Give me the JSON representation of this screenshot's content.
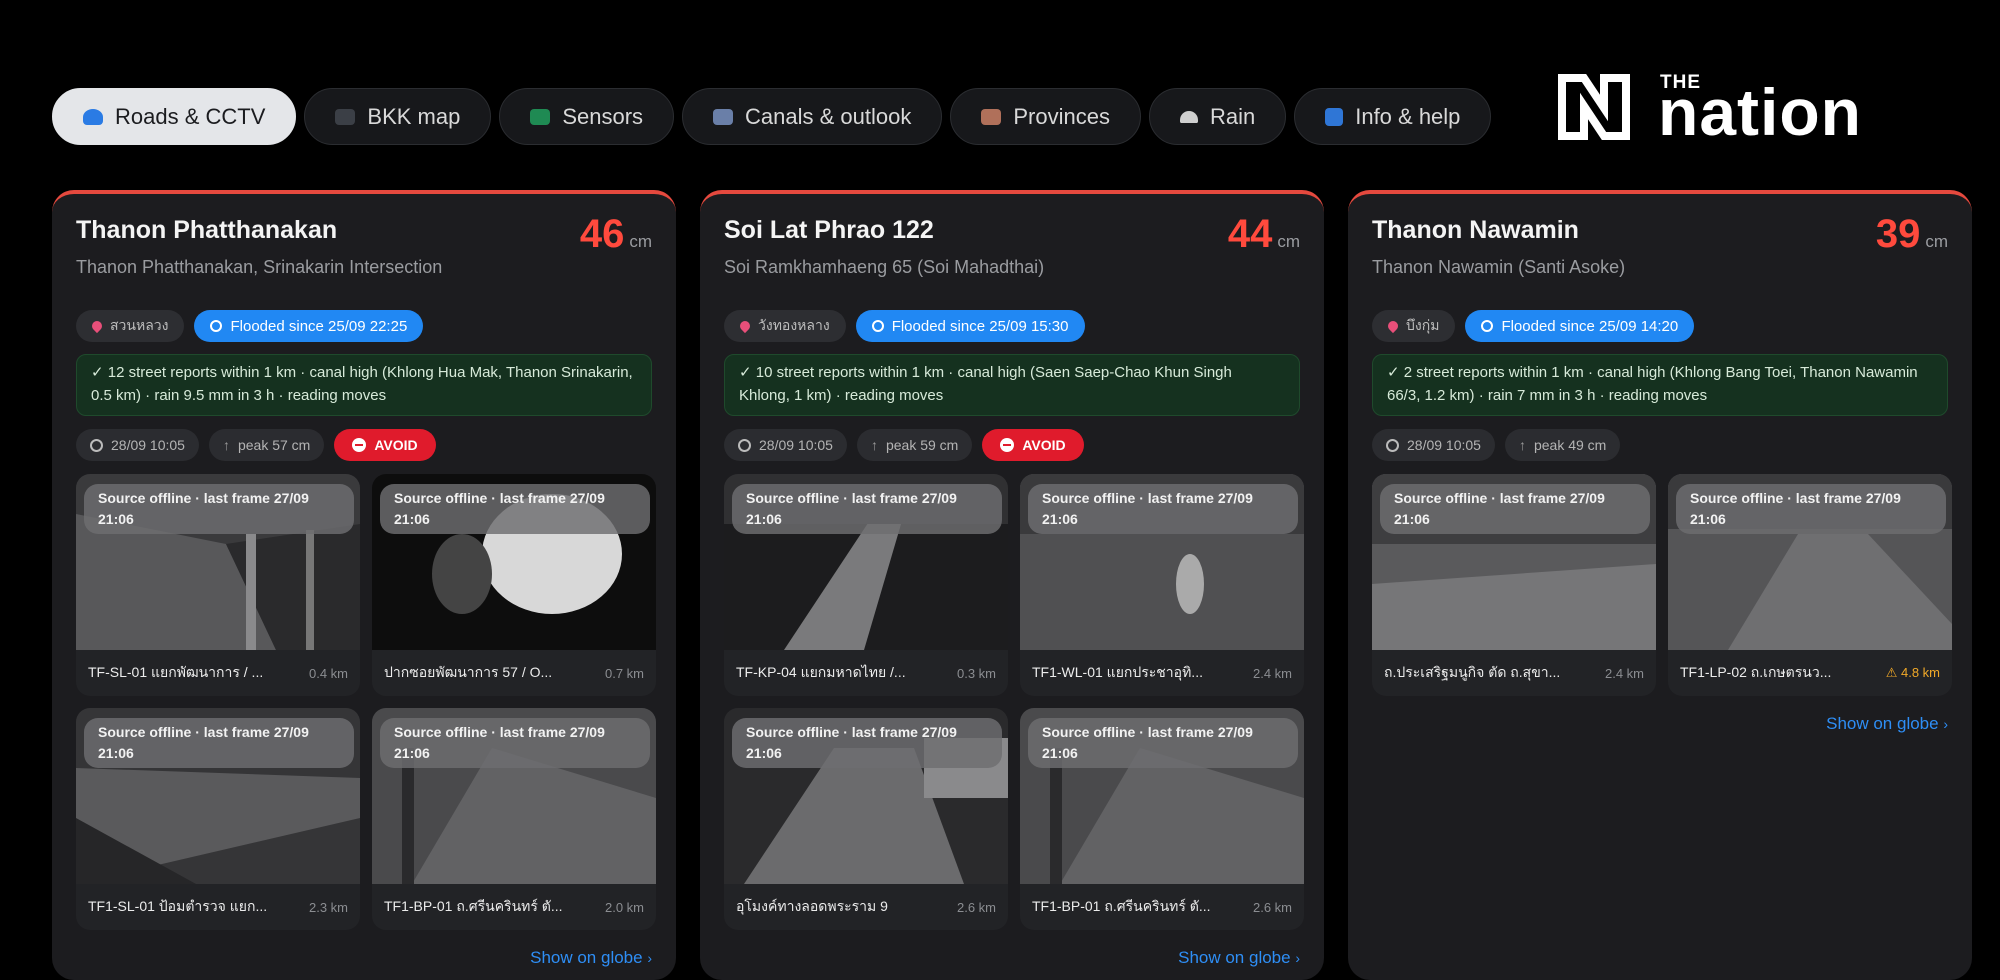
{
  "tabs": [
    {
      "label": "Roads & CCTV",
      "icon": "wave-icon",
      "active": true
    },
    {
      "label": "BKK map",
      "icon": "map-icon",
      "active": false
    },
    {
      "label": "Sensors",
      "icon": "sensor-icon",
      "active": false
    },
    {
      "label": "Canals & outlook",
      "icon": "chart-icon",
      "active": false
    },
    {
      "label": "Provinces",
      "icon": "provinces-icon",
      "active": false
    },
    {
      "label": "Rain",
      "icon": "umbrella-icon",
      "active": false
    },
    {
      "label": "Info & help",
      "icon": "info-icon",
      "active": false
    }
  ],
  "logo": {
    "small": "THE",
    "word": "nation"
  },
  "colors": {
    "accent_red": "#e5493e",
    "depth_red": "#ff4a3d",
    "flood_blue": "#2188f3",
    "avoid_red": "#e01b2c",
    "link_blue": "#2e8ef5",
    "warn_orange": "#f1a928"
  },
  "cards": [
    {
      "title": "Thanon Phatthanakan",
      "subtitle": "Thanon Phatthanakan, Srinakarin Intersection",
      "depth": "46",
      "unit": "cm",
      "district": "สวนหลวง",
      "flooded": "Flooded since 25/09 22:25",
      "report": "✓ 12 street reports within 1 km · canal high (Khlong Hua Mak, Thanon Srinakarin, 0.5 km) · rain 9.5 mm in 3 h · reading moves",
      "time": "28/09 10:05",
      "peak": "peak 57 cm",
      "avoid": "AVOID",
      "cams": [
        {
          "badge": "Source offline · last frame 27/09 21:06",
          "name": "TF-SL-01 แยกพัฒนาการ / ...",
          "dist": "0.4 km",
          "warn": false
        },
        {
          "badge": "Source offline · last frame 27/09 21:06",
          "name": "ปากซอยพัฒนาการ 57 / O...",
          "dist": "0.7 km",
          "warn": false
        },
        {
          "badge": "Source offline · last frame 27/09 21:06",
          "name": "TF1-SL-01 ป้อมตำรวจ แยก...",
          "dist": "2.3 km",
          "warn": false
        },
        {
          "badge": "Source offline · last frame 27/09 21:06",
          "name": "TF1-BP-01 ถ.ศรีนครินทร์ ตั...",
          "dist": "2.0 km",
          "warn": false
        }
      ],
      "link": "Show on globe"
    },
    {
      "title": "Soi Lat Phrao 122",
      "subtitle": "Soi Ramkhamhaeng 65 (Soi Mahadthai)",
      "depth": "44",
      "unit": "cm",
      "district": "วังทองหลาง",
      "flooded": "Flooded since 25/09 15:30",
      "report": "✓ 10 street reports within 1 km · canal high (Saen Saep-Chao Khun Singh Khlong, 1 km) · reading moves",
      "time": "28/09 10:05",
      "peak": "peak 59 cm",
      "avoid": "AVOID",
      "cams": [
        {
          "badge": "Source offline · last frame 27/09 21:06",
          "name": "TF-KP-04 แยกมหาดไทย /...",
          "dist": "0.3 km",
          "warn": false
        },
        {
          "badge": "Source offline · last frame 27/09 21:06",
          "name": "TF1-WL-01 แยกประชาอุทิ...",
          "dist": "2.4 km",
          "warn": false
        },
        {
          "badge": "Source offline · last frame 27/09 21:06",
          "name": "อุโมงค์ทางลอดพระราม 9",
          "dist": "2.6 km",
          "warn": false
        },
        {
          "badge": "Source offline · last frame 27/09 21:06",
          "name": "TF1-BP-01 ถ.ศรีนครินทร์ ตั...",
          "dist": "2.6 km",
          "warn": false
        }
      ],
      "link": "Show on globe"
    },
    {
      "title": "Thanon Nawamin",
      "subtitle": "Thanon Nawamin (Santi Asoke)",
      "depth": "39",
      "unit": "cm",
      "district": "บึงกุ่ม",
      "flooded": "Flooded since 25/09 14:20",
      "report": "✓ 2 street reports within 1 km · canal high (Khlong Bang Toei, Thanon Nawamin 66/3, 1.2 km) · rain 7 mm in 3 h · reading moves",
      "time": "28/09 10:05",
      "peak": "peak 49 cm",
      "avoid": "",
      "cams": [
        {
          "badge": "Source offline · last frame 27/09 21:06",
          "name": "ถ.ประเสริฐมนูกิจ ตัด ถ.สุขา...",
          "dist": "2.4 km",
          "warn": false
        },
        {
          "badge": "Source offline · last frame 27/09 21:06",
          "name": "TF1-LP-02 ถ.เกษตรนว...",
          "dist": "⚠ 4.8 km",
          "warn": true
        }
      ],
      "link": "Show on globe"
    }
  ]
}
